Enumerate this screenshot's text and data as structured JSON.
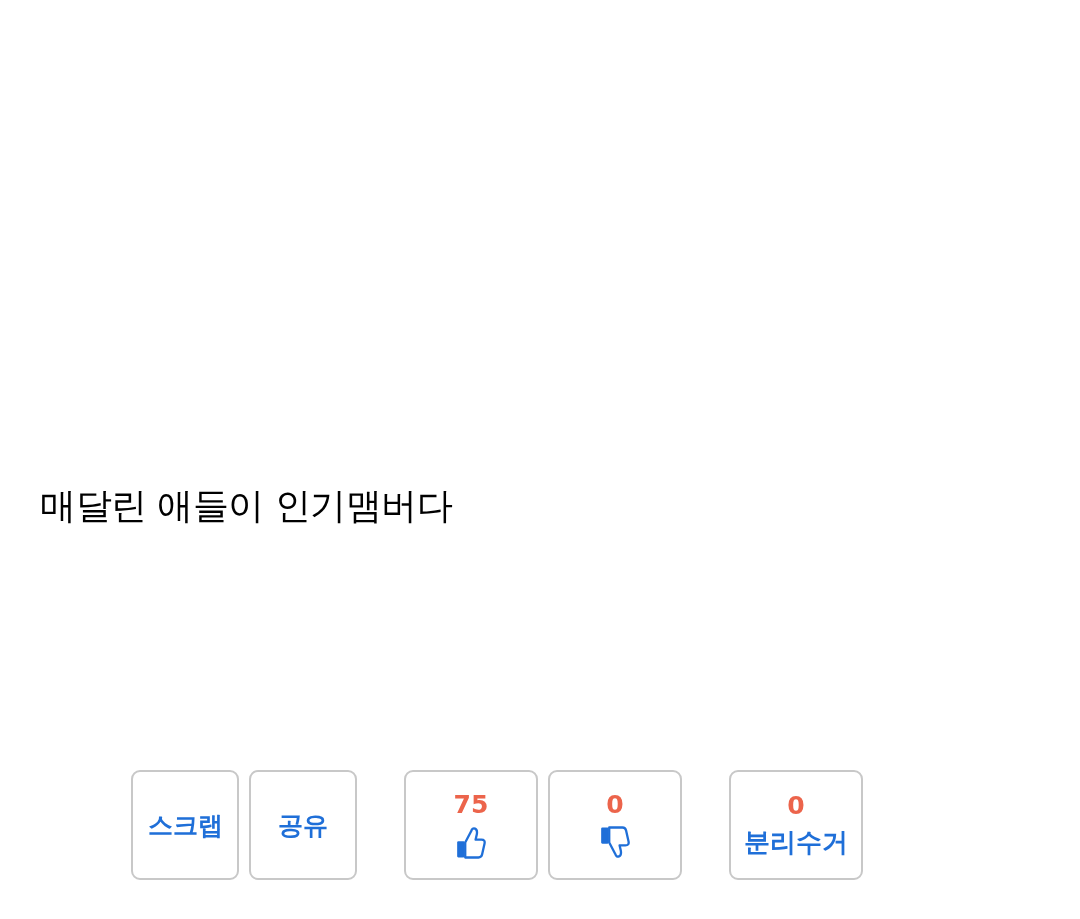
{
  "post": {
    "text": "매달린 애들이 인기맴버다"
  },
  "button_groups": [
    {
      "buttons": [
        {
          "kind": "text",
          "label": "스크랩"
        },
        {
          "kind": "text",
          "label": "공유"
        }
      ]
    },
    {
      "buttons": [
        {
          "kind": "upvote",
          "count": "75"
        },
        {
          "kind": "downvote",
          "count": "0"
        }
      ]
    },
    {
      "buttons": [
        {
          "kind": "counted",
          "count": "0",
          "label": "분리수거"
        }
      ]
    }
  ]
}
